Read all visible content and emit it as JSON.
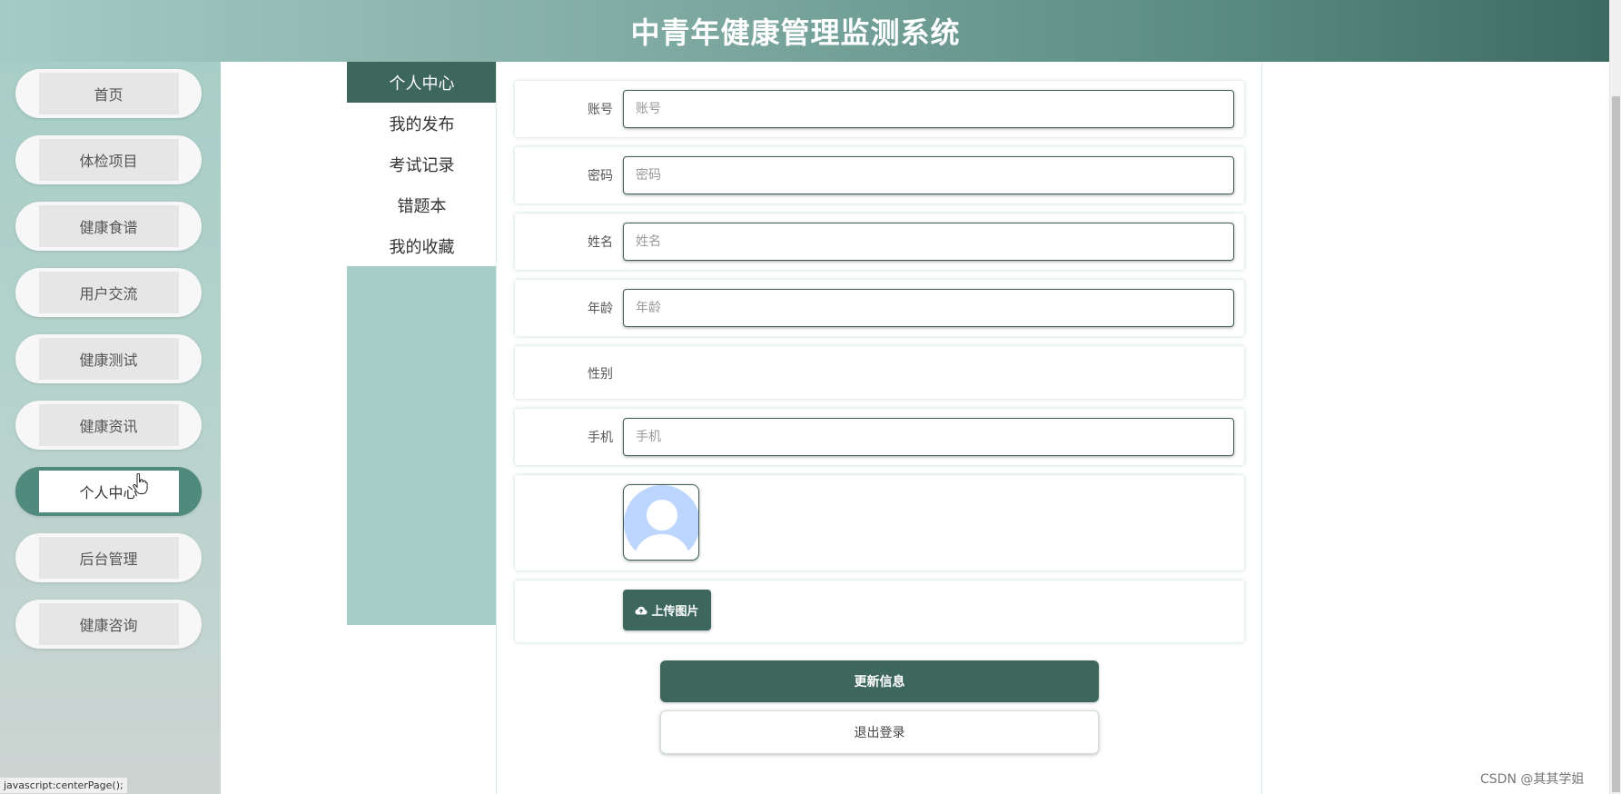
{
  "app": {
    "title": "中青年健康管理监测系统"
  },
  "sidebar": {
    "items": [
      {
        "label": "首页",
        "active": false
      },
      {
        "label": "体检项目",
        "active": false
      },
      {
        "label": "健康食谱",
        "active": false
      },
      {
        "label": "用户交流",
        "active": false
      },
      {
        "label": "健康测试",
        "active": false
      },
      {
        "label": "健康资讯",
        "active": false
      },
      {
        "label": "个人中心",
        "active": true
      },
      {
        "label": "后台管理",
        "active": false
      },
      {
        "label": "健康咨询",
        "active": false
      }
    ]
  },
  "submenu": {
    "items": [
      {
        "label": "个人中心",
        "active": true
      },
      {
        "label": "我的发布",
        "active": false
      },
      {
        "label": "考试记录",
        "active": false
      },
      {
        "label": "错题本",
        "active": false
      },
      {
        "label": "我的收藏",
        "active": false
      }
    ]
  },
  "form": {
    "account": {
      "label": "账号",
      "placeholder": "账号",
      "value": ""
    },
    "password": {
      "label": "密码",
      "placeholder": "密码",
      "value": ""
    },
    "name": {
      "label": "姓名",
      "placeholder": "姓名",
      "value": ""
    },
    "age": {
      "label": "年龄",
      "placeholder": "年龄",
      "value": ""
    },
    "gender": {
      "label": "性别",
      "value": ""
    },
    "phone": {
      "label": "手机",
      "placeholder": "手机",
      "value": ""
    },
    "avatar": {
      "icon": "user-avatar-placeholder-icon"
    },
    "upload": {
      "label": "上传图片",
      "icon": "cloud-upload-icon"
    },
    "update_button": "更新信息",
    "logout_button": "退出登录"
  },
  "status_bar": {
    "text": "javascript:centerPage();"
  },
  "watermark": "CSDN @其其学姐",
  "colors": {
    "primary": "#3d665c",
    "active_sidebar": "#4f8a7c",
    "sidebar_bg": "#a7cec6",
    "header_start": "#a5ccc4",
    "header_end": "#3e6b61"
  }
}
